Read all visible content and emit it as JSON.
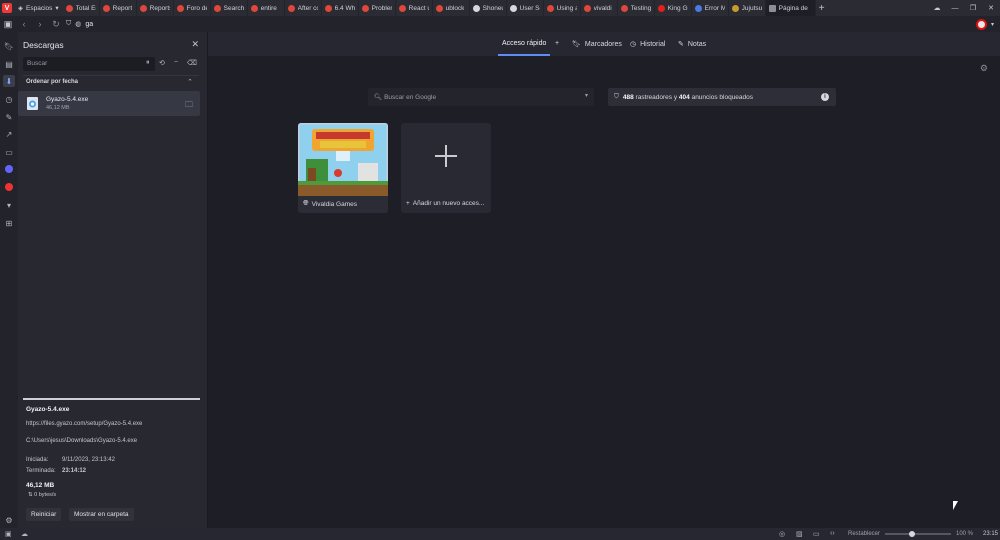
{
  "tabs": {
    "spaces_label": "Espacios",
    "items": [
      {
        "title": "Total Ec",
        "color": "#e0473b"
      },
      {
        "title": "Report",
        "color": "#e0473b"
      },
      {
        "title": "Reports",
        "color": "#e0473b"
      },
      {
        "title": "Foro de",
        "color": "#e0473b"
      },
      {
        "title": "Search",
        "color": "#e0473b"
      },
      {
        "title": "entire",
        "color": "#e0473b"
      },
      {
        "title": "After co",
        "color": "#e0473b"
      },
      {
        "title": "6.4 Wh",
        "color": "#e0473b"
      },
      {
        "title": "Problem",
        "color": "#e0473b"
      },
      {
        "title": "React u",
        "color": "#e0473b"
      },
      {
        "title": "ublock",
        "color": "#e0473b"
      },
      {
        "title": "Shoneu",
        "color": "#d8d9de"
      },
      {
        "title": "User Sc",
        "color": "#d8d9de"
      },
      {
        "title": "Using a",
        "color": "#e0473b"
      },
      {
        "title": "vivaldi",
        "color": "#e0473b"
      },
      {
        "title": "Testing",
        "color": "#e0473b"
      },
      {
        "title": "King Gi",
        "color": "#e2201e"
      },
      {
        "title": "Error M",
        "color": "#4d79e8"
      },
      {
        "title": "Jujutsu",
        "color": "#c99a2e"
      }
    ],
    "active_title": "Página de"
  },
  "address": {
    "text": "ga"
  },
  "downloads": {
    "title": "Descargas",
    "search_placeholder": "Buscar",
    "sort_label": "Ordenar por fecha",
    "item": {
      "name": "Gyazo-5.4.exe",
      "size": "46,12 MB"
    },
    "details": {
      "file": "Gyazo-5.4.exe",
      "url": "https://files.gyazo.com/setup/Gyazo-5.4.exe",
      "path": "C:\\Users\\jesus\\Downloads\\Gyazo-5.4.exe",
      "started_label": "Iniciada:",
      "started_value": "9/11/2023, 23:13:42",
      "finished_label": "Terminada:",
      "finished_value": "23:14:12",
      "size": "46,12 MB",
      "speed": "0 bytes/s"
    },
    "buttons": {
      "restart": "Reiniciar",
      "show_folder": "Mostrar en carpeta"
    }
  },
  "startpage": {
    "nav": {
      "speed_dial": "Acceso rápido",
      "bookmarks": "Marcadores",
      "history": "Historial",
      "notes": "Notas"
    },
    "search_placeholder": "Buscar en Google",
    "trackers_count": "488",
    "trackers_text": "rastreadores y",
    "ads_count": "404",
    "ads_text": "anuncios bloqueados",
    "tiles": [
      {
        "label": "Vivaldia Games"
      },
      {
        "label": "Añadir un nuevo acces..."
      }
    ]
  },
  "statusbar": {
    "reset_label": "Restablecer",
    "zoom": "100 %",
    "clock": "23:15"
  }
}
